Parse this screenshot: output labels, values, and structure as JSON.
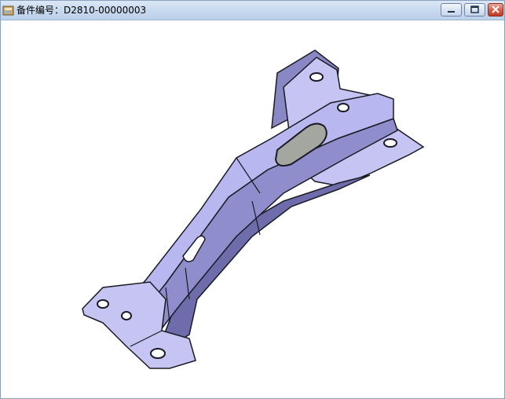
{
  "window": {
    "title": "备件编号：D2810-00000003",
    "controls": {
      "minimize": "minimize-icon",
      "maximize": "maximize-icon",
      "close": "close-icon"
    }
  },
  "viewer": {
    "model": "part-3d-model"
  },
  "colors": {
    "part_fill": "#b9b7ef",
    "part_shadow": "#7d7bb8",
    "edge": "#1a1a24",
    "titlebar": "#c6d8ee"
  }
}
